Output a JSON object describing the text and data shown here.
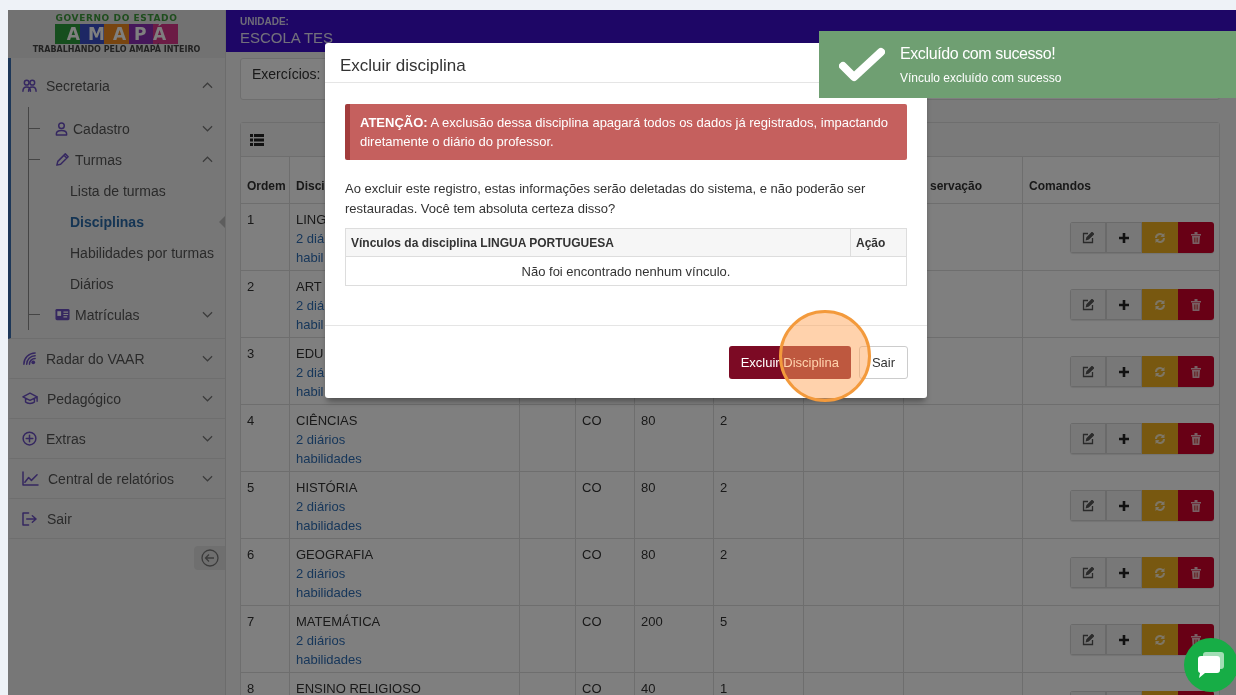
{
  "logo": {
    "top": "GOVERNO DO ESTADO",
    "word": "AMAPÁ",
    "tagline": "TRABALHANDO PELO AMAPÁ INTEIRO"
  },
  "sidebar": {
    "items": [
      {
        "label": "Secretaria",
        "expanded": true,
        "children": [
          {
            "label": "Cadastro",
            "expanded": false
          },
          {
            "label": "Turmas",
            "expanded": true,
            "children": [
              {
                "label": "Lista de turmas",
                "selected": false
              },
              {
                "label": "Disciplinas",
                "selected": true
              },
              {
                "label": "Habilidades por turmas",
                "selected": false
              },
              {
                "label": "Diários",
                "selected": false
              }
            ]
          },
          {
            "label": "Matrículas",
            "expanded": false
          }
        ]
      },
      {
        "label": "Radar do VAAR",
        "expanded": false
      },
      {
        "label": "Pedagógico",
        "expanded": false
      },
      {
        "label": "Extras",
        "expanded": false
      },
      {
        "label": "Central de relatórios",
        "expanded": false
      },
      {
        "label": "Sair"
      }
    ]
  },
  "header": {
    "unit_label": "UNIDADE:",
    "unit_name": "ESCOLA TES"
  },
  "filter": {
    "label": "Exercícios:"
  },
  "table": {
    "columns": {
      "order": "Ordem",
      "subject": "Disci",
      "column_7": "servação",
      "commands": "Comandos"
    },
    "rows": [
      {
        "order": "1",
        "subject": "LING",
        "diaries": "2 diá",
        "skills": "habil"
      },
      {
        "order": "2",
        "subject": "ART",
        "diaries": "2 diá",
        "skills": "habil"
      },
      {
        "order": "3",
        "subject": "EDU",
        "diaries": "2 diá",
        "skills": "habil"
      },
      {
        "order": "4",
        "subject": "CIÊNCIAS",
        "diaries": "2 diários",
        "skills": "habilidades",
        "column_4": "CO",
        "column_5": "80",
        "column_6": "2"
      },
      {
        "order": "5",
        "subject": "HISTÓRIA",
        "diaries": "2 diários",
        "skills": "habilidades",
        "column_4": "CO",
        "column_5": "80",
        "column_6": "2"
      },
      {
        "order": "6",
        "subject": "GEOGRAFIA",
        "diaries": "2 diários",
        "skills": "habilidades",
        "column_4": "CO",
        "column_5": "80",
        "column_6": "2"
      },
      {
        "order": "7",
        "subject": "MATEMÁTICA",
        "diaries": "2 diários",
        "skills": "habilidades",
        "column_4": "CO",
        "column_5": "200",
        "column_6": "5"
      },
      {
        "order": "8",
        "subject": "ENSINO RELIGIOSO",
        "column_4": "CO",
        "column_5": "40",
        "column_6": "1"
      }
    ]
  },
  "modal": {
    "title": "Excluir disciplina",
    "alert": "**ATENÇÃO:** A exclusão dessa disciplina apagará todos os dados já registrados, impactando diretamente o diário do professor.",
    "message": "Ao excluir este registro, estas informações serão deletadas do sistema, e não poderão ser restauradas. Você tem absoluta certeza disso?",
    "links_table": {
      "columns": [
        "Vínculos da disciplina LINGUA PORTUGUESA",
        "Ação"
      ],
      "empty": "Não foi encontrado nenhum vínculo."
    },
    "buttons": [
      {
        "label": "Excluir Disciplina",
        "kind": "danger"
      },
      {
        "label": "Sair",
        "kind": "default"
      }
    ]
  },
  "toast": {
    "title": "Excluído com sucesso!",
    "message": "Vínculo excluído com sucesso"
  }
}
